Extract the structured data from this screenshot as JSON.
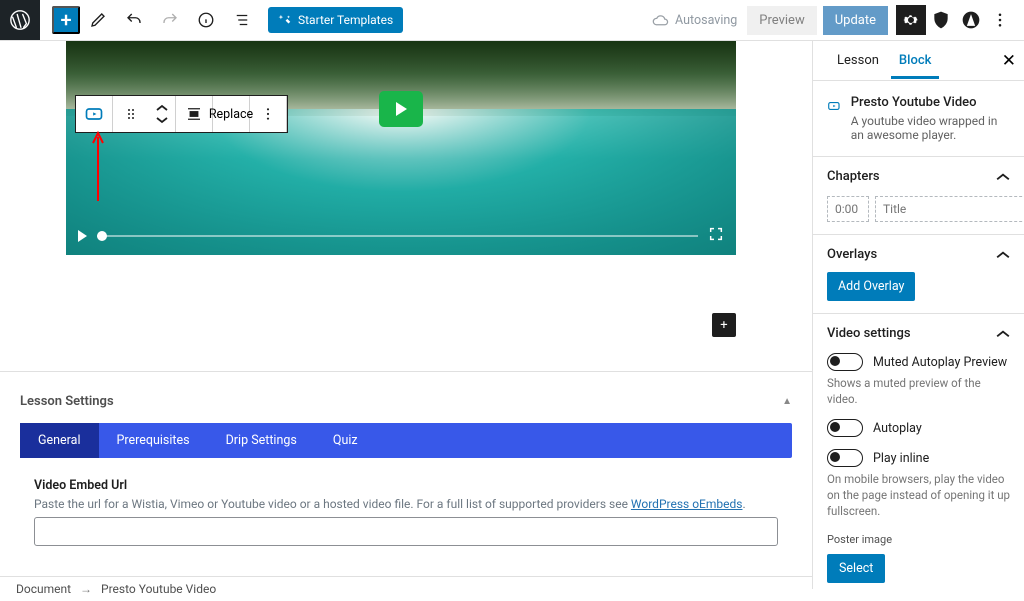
{
  "toolbar": {
    "starter_label": "Starter Templates",
    "autosaving_label": "Autosaving",
    "preview_label": "Preview",
    "update_label": "Update"
  },
  "block_toolbar": {
    "replace_label": "Replace"
  },
  "metabox": {
    "title": "Lesson Settings",
    "tabs": [
      "General",
      "Prerequisites",
      "Drip Settings",
      "Quiz"
    ],
    "field_label": "Video Embed Url",
    "field_help_prefix": "Paste the url for a Wistia, Vimeo or Youtube video or a hosted video file. For a full list of supported providers see ",
    "field_help_link": "WordPress oEmbeds",
    "field_help_suffix": "."
  },
  "breadcrumb": {
    "root": "Document",
    "current": "Presto Youtube Video"
  },
  "sidebar": {
    "tabs": {
      "lesson": "Lesson",
      "block": "Block"
    },
    "block_info": {
      "title": "Presto Youtube Video",
      "desc": "A youtube video wrapped in an awesome player."
    },
    "chapters": {
      "title": "Chapters",
      "time_placeholder": "0:00",
      "title_placeholder": "Title"
    },
    "overlays": {
      "title": "Overlays",
      "add_label": "Add Overlay"
    },
    "video_settings": {
      "title": "Video settings",
      "muted_label": "Muted Autoplay Preview",
      "muted_help": "Shows a muted preview of the video.",
      "autoplay_label": "Autoplay",
      "inline_label": "Play inline",
      "inline_help": "On mobile browsers, play the video on the page instead of opening it up fullscreen.",
      "poster_label": "Poster image",
      "select_label": "Select"
    }
  }
}
